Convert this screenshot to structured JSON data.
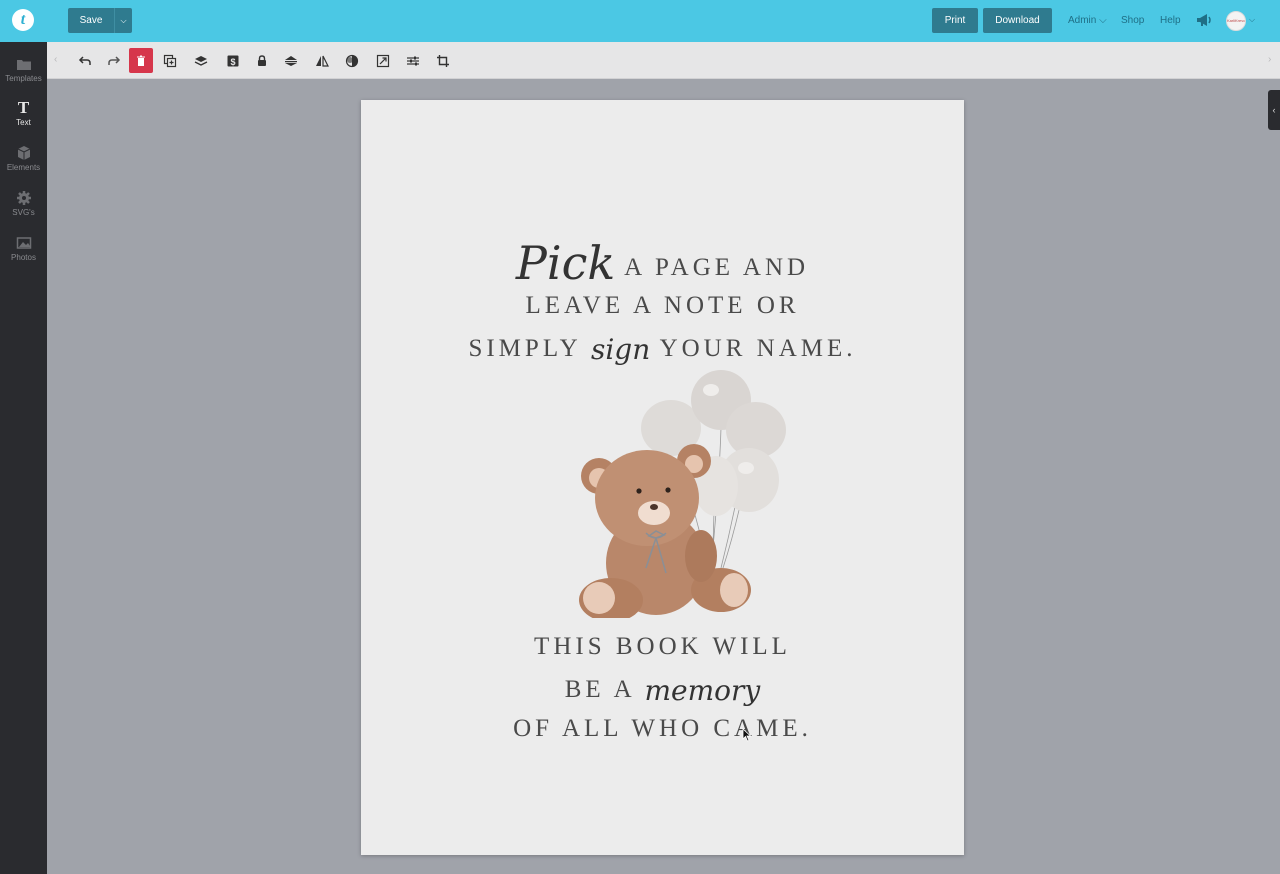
{
  "topbar": {
    "logo": "t",
    "save_label": "Save",
    "save_caret": "⌵",
    "print_label": "Print",
    "download_label": "Download",
    "admin_label": "Admin ⌵",
    "shop_label": "Shop",
    "help_label": "Help",
    "avatar_text": "KarliKrevo",
    "avatar_caret": "⌵"
  },
  "sidebar": {
    "items": [
      {
        "label": "Templates",
        "icon": "folder-icon"
      },
      {
        "label": "Text",
        "icon": "text-icon"
      },
      {
        "label": "Elements",
        "icon": "cube-icon"
      },
      {
        "label": "SVG's",
        "icon": "gear-icon"
      },
      {
        "label": "Photos",
        "icon": "image-icon"
      }
    ],
    "text_glyph": "T"
  },
  "toolbar": {
    "tools": [
      "undo-icon",
      "redo-icon",
      "trash-icon",
      "duplicate-icon",
      "layers-icon",
      "currency-icon",
      "lock-icon",
      "align-icon",
      "flip-icon",
      "opacity-icon",
      "resize-icon",
      "sliders-icon",
      "crop-icon"
    ],
    "left_arrow": "‹",
    "right_arrow": "›"
  },
  "right_handle": "‹",
  "canvas": {
    "line1_script": "Pick",
    "line1_rest": " A PAGE AND",
    "line2": "LEAVE A NOTE OR",
    "line3_pre": "SIMPLY ",
    "line3_script": "sign",
    "line3_post": " YOUR NAME.",
    "line4": "THIS BOOK WILL",
    "line5_pre": "BE A ",
    "line5_script": "memory",
    "line6": "OF ALL WHO CAME."
  },
  "colors": {
    "topbar": "#4bc8e4",
    "button": "#2f7b8f",
    "sidebar": "#2a2b2f",
    "delete": "#d6364b",
    "page": "#ececec"
  }
}
